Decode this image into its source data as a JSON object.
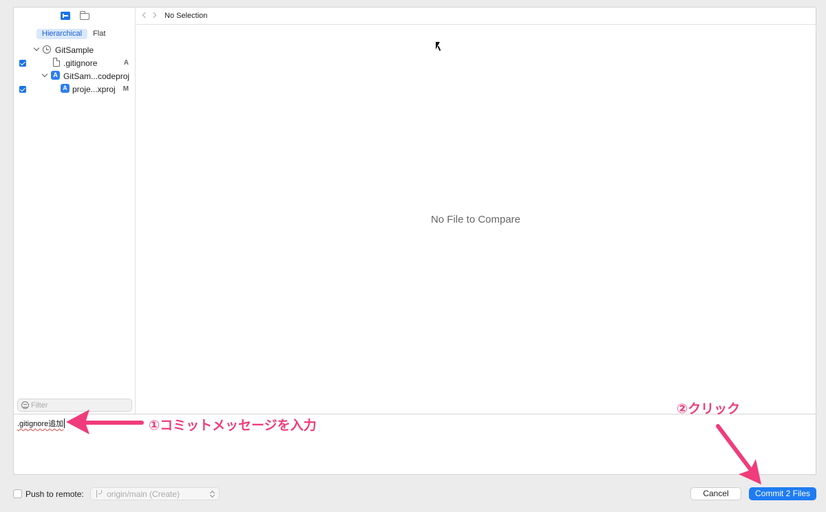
{
  "sidebar": {
    "segments": [
      {
        "label": "Hierarchical",
        "active": true
      },
      {
        "label": "Flat",
        "active": false
      }
    ],
    "tree": [
      {
        "label": "GitSample",
        "status": "",
        "icon": "clock-icon",
        "checked": false
      },
      {
        "label": ".gitignore",
        "status": "A",
        "icon": "file-icon",
        "checked": true
      },
      {
        "label": "GitSam...codeproj",
        "status": "",
        "icon": "xcodeproj-icon",
        "checked": false
      },
      {
        "label": "proje...xproj",
        "status": "M",
        "icon": "xcodeproj-icon",
        "checked": true
      }
    ],
    "filter_placeholder": "Filter"
  },
  "main": {
    "breadcrumb": "No Selection",
    "empty_message": "No File to Compare"
  },
  "commit_message": {
    "text": ".gitignore追加"
  },
  "annotations": {
    "step1": "①コミットメッセージを入力",
    "step2": "②クリック",
    "color": "#f03c7a"
  },
  "bottom_bar": {
    "push_label": "Push to remote:",
    "push_checked": false,
    "branch": "origin/main (Create)",
    "cancel_label": "Cancel",
    "commit_label": "Commit 2 Files"
  },
  "colors": {
    "accent": "#1e7cf2"
  }
}
